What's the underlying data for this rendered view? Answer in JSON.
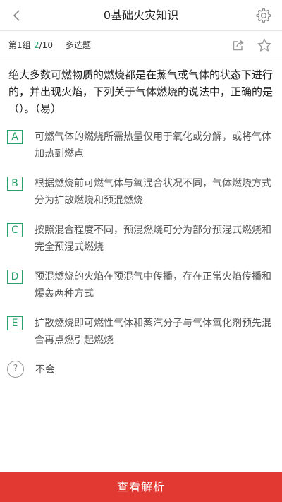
{
  "header": {
    "title": "0基础火灾知识",
    "back_icon": "chevron-left-icon",
    "settings_icon": "gear-icon"
  },
  "subbar": {
    "group": "第1组",
    "progress_current": "2",
    "progress_total": "/10",
    "question_type": "多选题",
    "share_icon": "share-icon",
    "star_icon": "star-icon"
  },
  "question": {
    "text": "绝大多数可燃物质的燃烧都是在蒸气或气体的状态下进行的，并出现火焰，下列关于气体燃烧的说法中，正确的是（）。（易）"
  },
  "options": [
    {
      "letter": "A",
      "text": "可燃气体的燃烧所需热量仅用于氧化或分解，或将气体加热到燃点"
    },
    {
      "letter": "B",
      "text": "根据燃烧前可燃气体与氧混合状况不同，气体燃烧方式分为扩散燃烧和预混燃烧"
    },
    {
      "letter": "C",
      "text": "按照混合程度不同，预混燃烧可分为部分预混式燃烧和完全预混式燃烧"
    },
    {
      "letter": "D",
      "text": "预混燃烧的火焰在预混气中传播，存在正常火焰传播和爆轰两种方式"
    },
    {
      "letter": "E",
      "text": "扩散燃烧即可燃性气体和蒸汽分子与气体氧化剂预先混合再点燃引起燃烧"
    }
  ],
  "unknown": {
    "symbol": "?",
    "label": "不会"
  },
  "footer": {
    "button_label": "查看解析"
  },
  "colors": {
    "accent_green": "#2aa06a",
    "footer_red": "#e23a32"
  }
}
